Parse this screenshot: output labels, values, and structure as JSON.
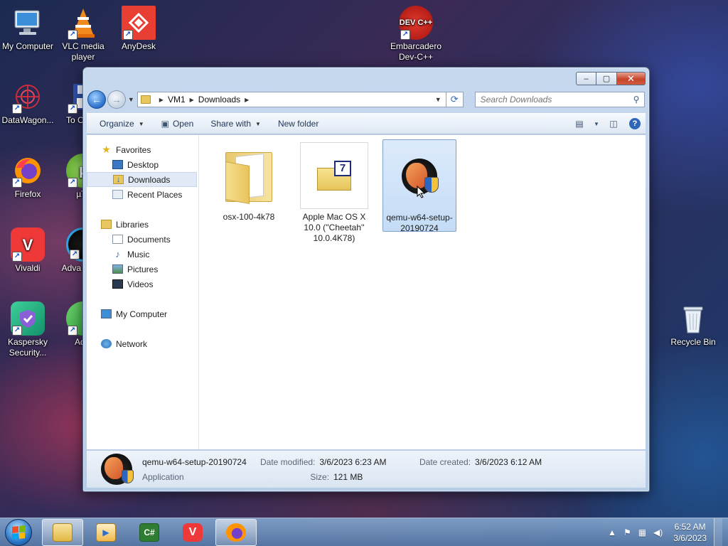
{
  "desktop": {
    "icons": [
      {
        "label": "My Computer",
        "icon": "computer-icon"
      },
      {
        "label": "VLC media player",
        "icon": "vlc-icon"
      },
      {
        "label": "AnyDesk",
        "icon": "anydesk-icon"
      },
      {
        "label": "Embarcadero Dev-C++",
        "icon": "devcpp-icon",
        "glyph": "DEV C++"
      },
      {
        "label": "DataWagon...",
        "icon": "datawagon-icon"
      },
      {
        "label": "To Comn",
        "icon": "floppy-icon"
      },
      {
        "label": "Firefox",
        "icon": "firefox-icon"
      },
      {
        "label": "µTo",
        "icon": "utorrent-icon"
      },
      {
        "label": "Vivaldi",
        "icon": "vivaldi-icon",
        "glyph": "V"
      },
      {
        "label": "Adva Syste",
        "icon": "advanced-systemcare-icon"
      },
      {
        "label": "Kaspersky Security...",
        "icon": "kaspersky-icon"
      },
      {
        "label": "AdG",
        "icon": "adguard-icon"
      },
      {
        "label": "Recycle Bin",
        "icon": "recycle-bin-icon"
      }
    ]
  },
  "window": {
    "controls": {
      "minimize": "–",
      "maximize": "▢",
      "close": "✕"
    },
    "address": {
      "crumbs": [
        "VM1",
        "Downloads"
      ]
    },
    "search": {
      "placeholder": "Search Downloads"
    },
    "toolbar": {
      "organize": "Organize",
      "open": "Open",
      "share_with": "Share with",
      "new_folder": "New folder",
      "help": "?"
    },
    "nav_pane": {
      "favorites": "Favorites",
      "favorites_items": [
        "Desktop",
        "Downloads",
        "Recent Places"
      ],
      "libraries": "Libraries",
      "libraries_items": [
        "Documents",
        "Music",
        "Pictures",
        "Videos"
      ],
      "computer": "My Computer",
      "network": "Network",
      "selected": "Downloads"
    },
    "files": [
      {
        "name": "osx-100-4k78",
        "type": "folder"
      },
      {
        "name": "Apple Mac OS X 10.0 (''Cheetah'' 10.0.4K78)",
        "type": "archive",
        "badge": "7"
      },
      {
        "name": "qemu-w64-setup-20190724",
        "type": "application",
        "selected": true
      }
    ],
    "details": {
      "name": "qemu-w64-setup-20190724",
      "type": "Application",
      "date_modified_label": "Date modified:",
      "date_modified": "3/6/2023 6:23 AM",
      "size_label": "Size:",
      "size": "121 MB",
      "date_created_label": "Date created:",
      "date_created": "3/6/2023 6:12 AM"
    }
  },
  "taskbar": {
    "apps": [
      {
        "name": "Windows Explorer",
        "icon": "explorer-icon",
        "active": true
      },
      {
        "name": "Media Player",
        "icon": "media-player-icon",
        "active": false
      },
      {
        "name": "C# Editor",
        "icon": "csharp-icon",
        "glyph": "C#",
        "active": false
      },
      {
        "name": "Vivaldi",
        "icon": "vivaldi-icon",
        "glyph": "V",
        "active": false
      },
      {
        "name": "Firefox",
        "icon": "firefox-icon",
        "active": true
      }
    ],
    "clock": {
      "time": "6:52 AM",
      "date": "3/6/2023"
    }
  }
}
